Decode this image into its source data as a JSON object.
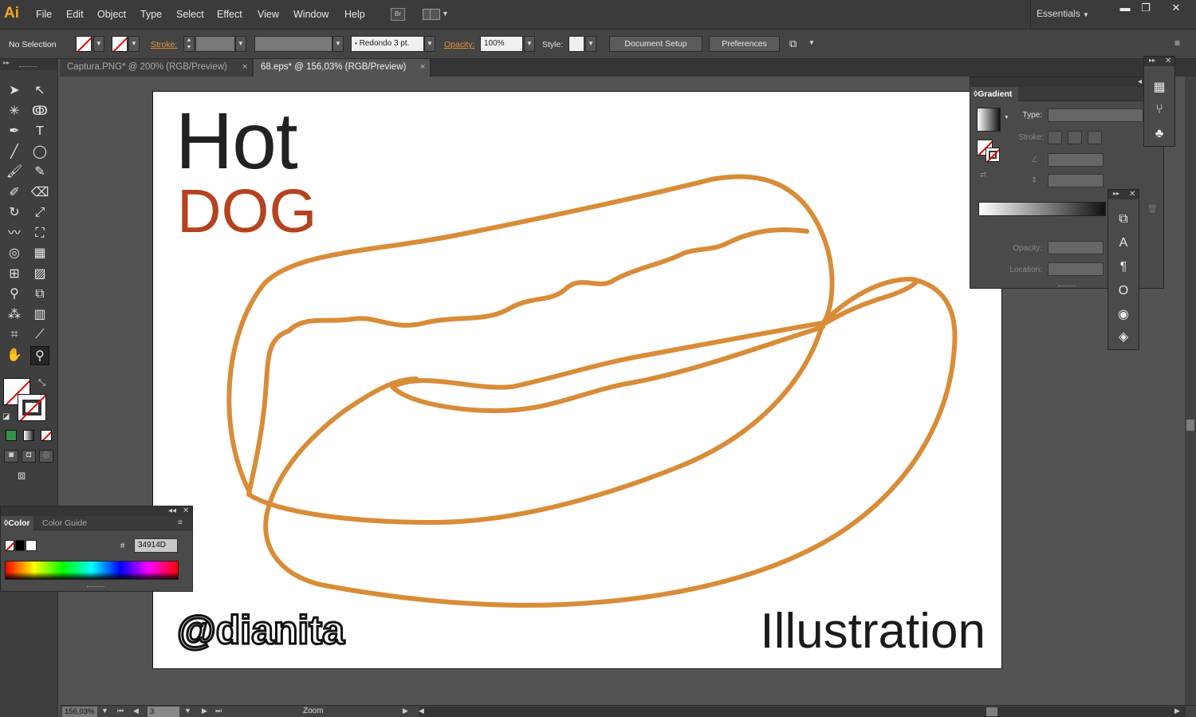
{
  "app": {
    "logo": "Ai"
  },
  "menu": [
    "File",
    "Edit",
    "Object",
    "Type",
    "Select",
    "Effect",
    "View",
    "Window",
    "Help"
  ],
  "bridge_label": "Br",
  "workspace": "Essentials",
  "window_controls": {
    "minimize": "▬",
    "restore": "❐",
    "close": "✕"
  },
  "control": {
    "selection": "No Selection",
    "stroke_label": "Stroke:",
    "brush_value": "Redondo 3 pt.",
    "opacity_label": "Opacity:",
    "opacity_value": "100%",
    "style_label": "Style:",
    "document_setup": "Document Setup",
    "preferences": "Preferences"
  },
  "tabs": [
    {
      "label": "Captura.PNG* @ 200% (RGB/Preview)",
      "close": "×"
    },
    {
      "label": "68.eps* @ 156,03% (RGB/Preview)",
      "close": "×"
    }
  ],
  "artwork": {
    "title": "Hot",
    "subtitle": "DOG",
    "signature": "@dianita",
    "caption": "Illustration",
    "stroke_color": "#D98C38",
    "title_color": "#222222",
    "subtitle_color": "#B5431F"
  },
  "gradient_panel": {
    "tab": "Gradient",
    "type_label": "Type:",
    "stroke_label": "Stroke:",
    "opacity_label": "Opacity:",
    "location_label": "Location:"
  },
  "color_panel": {
    "tabs": [
      "Color",
      "Color Guide"
    ],
    "hex_prefix": "#",
    "hex_value": "34914D"
  },
  "status": {
    "zoom": "156,03%",
    "page": "3",
    "tool_text": "Zoom"
  },
  "tools": [
    {
      "name": "selection-tool-icon",
      "glyph": "➤"
    },
    {
      "name": "direct-selection-tool-icon",
      "glyph": "↖"
    },
    {
      "name": "magic-wand-tool-icon",
      "glyph": "✳"
    },
    {
      "name": "lasso-tool-icon",
      "glyph": "ↂ"
    },
    {
      "name": "pen-tool-icon",
      "glyph": "✒"
    },
    {
      "name": "type-tool-icon",
      "glyph": "T"
    },
    {
      "name": "line-tool-icon",
      "glyph": "╱"
    },
    {
      "name": "ellipse-tool-icon",
      "glyph": "◯"
    },
    {
      "name": "paintbrush-tool-icon",
      "glyph": "🖌"
    },
    {
      "name": "pencil-tool-icon",
      "glyph": "✎"
    },
    {
      "name": "blob-brush-tool-icon",
      "glyph": "✐"
    },
    {
      "name": "eraser-tool-icon",
      "glyph": "⌫"
    },
    {
      "name": "rotate-tool-icon",
      "glyph": "↻"
    },
    {
      "name": "scale-tool-icon",
      "glyph": "⤢"
    },
    {
      "name": "warp-tool-icon",
      "glyph": "〰"
    },
    {
      "name": "free-transform-tool-icon",
      "glyph": "⛶"
    },
    {
      "name": "shape-builder-tool-icon",
      "glyph": "◎"
    },
    {
      "name": "perspective-grid-tool-icon",
      "glyph": "▦"
    },
    {
      "name": "mesh-tool-icon",
      "glyph": "⊞"
    },
    {
      "name": "gradient-tool-icon",
      "glyph": "▨"
    },
    {
      "name": "eyedropper-tool-icon",
      "glyph": "⚲"
    },
    {
      "name": "blend-tool-icon",
      "glyph": "⧉"
    },
    {
      "name": "symbol-sprayer-tool-icon",
      "glyph": "⁂"
    },
    {
      "name": "column-graph-tool-icon",
      "glyph": "▥"
    },
    {
      "name": "artboard-tool-icon",
      "glyph": "⌗"
    },
    {
      "name": "slice-tool-icon",
      "glyph": "⟋"
    },
    {
      "name": "hand-tool-icon",
      "glyph": "✋"
    },
    {
      "name": "zoom-tool-icon",
      "glyph": "⚲"
    }
  ]
}
